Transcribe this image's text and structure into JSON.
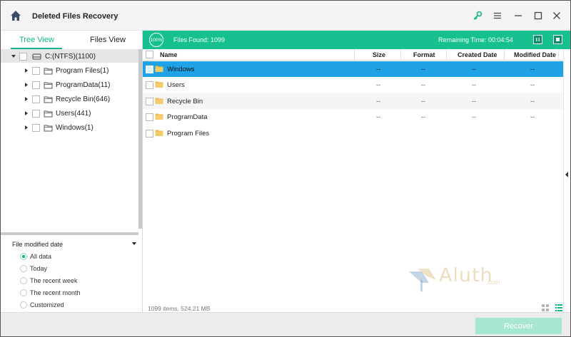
{
  "app": {
    "title": "Deleted Files Recovery"
  },
  "left_tabs": {
    "tree_view": "Tree View",
    "files_view": "Files View"
  },
  "tree": {
    "root": "C:(NTFS)(1100)",
    "items": [
      {
        "label": "Program Files(1)"
      },
      {
        "label": "ProgramData(11)"
      },
      {
        "label": "Recycle Bin(646)"
      },
      {
        "label": "Users(441)"
      },
      {
        "label": "Windows(1)"
      }
    ]
  },
  "filter": {
    "title": "File modified date",
    "options": [
      "All data",
      "Today",
      "The recent week",
      "The recent month",
      "Customized"
    ],
    "selected": "All data"
  },
  "scan": {
    "percent": "100%",
    "files_found": "Files Found:  1099",
    "remaining": "Remaining Time: 00:04:54"
  },
  "table": {
    "columns": [
      "Name",
      "Size",
      "Format",
      "Created Date",
      "Modified Date"
    ],
    "rows": [
      {
        "name": "Windows",
        "size": "--",
        "format": "--",
        "created": "--",
        "modified": "--"
      },
      {
        "name": "Users",
        "size": "--",
        "format": "--",
        "created": "--",
        "modified": "--"
      },
      {
        "name": "Recycle Bin",
        "size": "--",
        "format": "--",
        "created": "--",
        "modified": "--"
      },
      {
        "name": "ProgramData",
        "size": "--",
        "format": "--",
        "created": "--",
        "modified": "--"
      },
      {
        "name": "Program Files",
        "size": "--",
        "format": "--",
        "created": "--",
        "modified": "--"
      }
    ],
    "selected_row": "Windows"
  },
  "footer": {
    "info": "1099 items, 524.21 MB"
  },
  "watermark": {
    "text": "Aluth",
    "suffix": ".com"
  },
  "buttons": {
    "recover": "Recover"
  },
  "colors": {
    "accent": "#16c08f",
    "selection": "#1fa3e6",
    "recover_disabled": "#a6e6d3"
  },
  "icons": [
    "home-icon",
    "key-icon",
    "menu-icon",
    "minimize-icon",
    "maximize-icon",
    "close-icon",
    "drive-icon",
    "folder-icon",
    "pause-icon",
    "stop-icon",
    "grid-view-icon",
    "list-view-icon",
    "chevron-down-icon",
    "chevron-right-icon"
  ]
}
